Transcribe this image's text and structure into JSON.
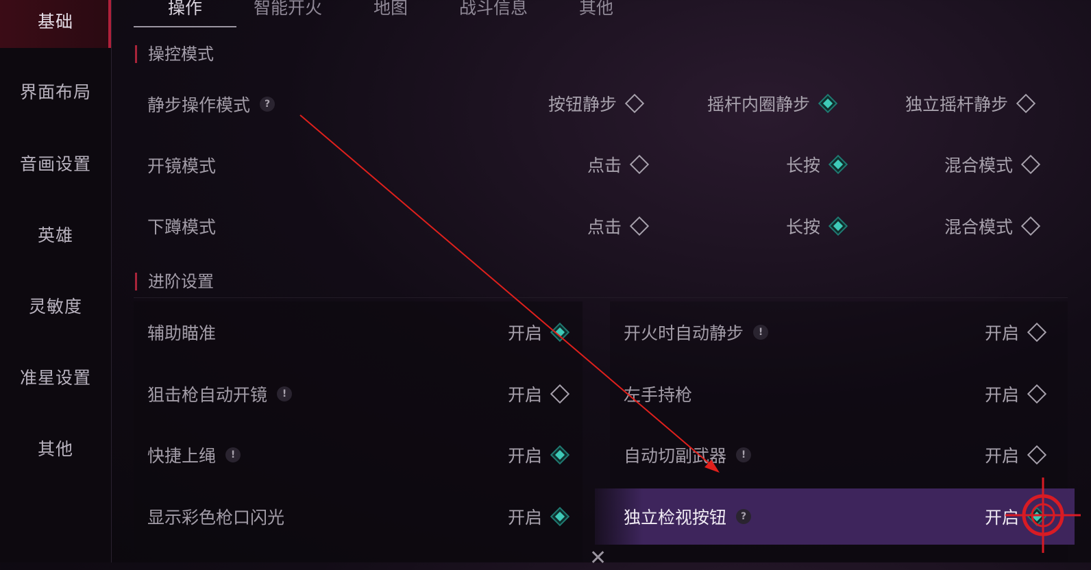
{
  "sidebar": {
    "items": [
      {
        "label": "基础",
        "active": true
      },
      {
        "label": "界面布局"
      },
      {
        "label": "音画设置"
      },
      {
        "label": "英雄"
      },
      {
        "label": "灵敏度"
      },
      {
        "label": "准星设置"
      },
      {
        "label": "其他"
      }
    ]
  },
  "tabs": [
    {
      "label": "操作",
      "active": true
    },
    {
      "label": "智能开火"
    },
    {
      "label": "地图"
    },
    {
      "label": "战斗信息"
    },
    {
      "label": "其他"
    }
  ],
  "sections": {
    "control": "操控模式",
    "advanced": "进阶设置"
  },
  "control_rows": [
    {
      "label": "静步操作模式",
      "help": "?",
      "options": [
        {
          "label": "按钮静步",
          "selected": false
        },
        {
          "label": "摇杆内圈静步",
          "selected": true
        },
        {
          "label": "独立摇杆静步",
          "selected": false
        }
      ]
    },
    {
      "label": "开镜模式",
      "options": [
        {
          "label": "点击",
          "selected": false
        },
        {
          "label": "长按",
          "selected": true
        },
        {
          "label": "混合模式",
          "selected": false
        }
      ]
    },
    {
      "label": "下蹲模式",
      "options": [
        {
          "label": "点击",
          "selected": false
        },
        {
          "label": "长按",
          "selected": true
        },
        {
          "label": "混合模式",
          "selected": false
        }
      ]
    }
  ],
  "advanced_left": [
    {
      "label": "辅助瞄准",
      "badge": "",
      "value": "开启",
      "on": true
    },
    {
      "label": "狙击枪自动开镜",
      "badge": "!",
      "value": "开启",
      "on": false
    },
    {
      "label": "快捷上绳",
      "badge": "!",
      "value": "开启",
      "on": true
    },
    {
      "label": "显示彩色枪口闪光",
      "badge": "",
      "value": "开启",
      "on": true
    }
  ],
  "advanced_right": [
    {
      "label": "开火时自动静步",
      "badge": "!",
      "value": "开启",
      "on": false
    },
    {
      "label": "左手持枪",
      "badge": "",
      "value": "开启",
      "on": false
    },
    {
      "label": "自动切副武器",
      "badge": "!",
      "value": "开启",
      "on": false
    },
    {
      "label": "独立检视按钮",
      "badge": "?",
      "value": "开启",
      "on": true
    }
  ],
  "colors": {
    "accent": "#b0203a",
    "toggle_on": "#3fcab8",
    "arrow": "#e0201c"
  }
}
